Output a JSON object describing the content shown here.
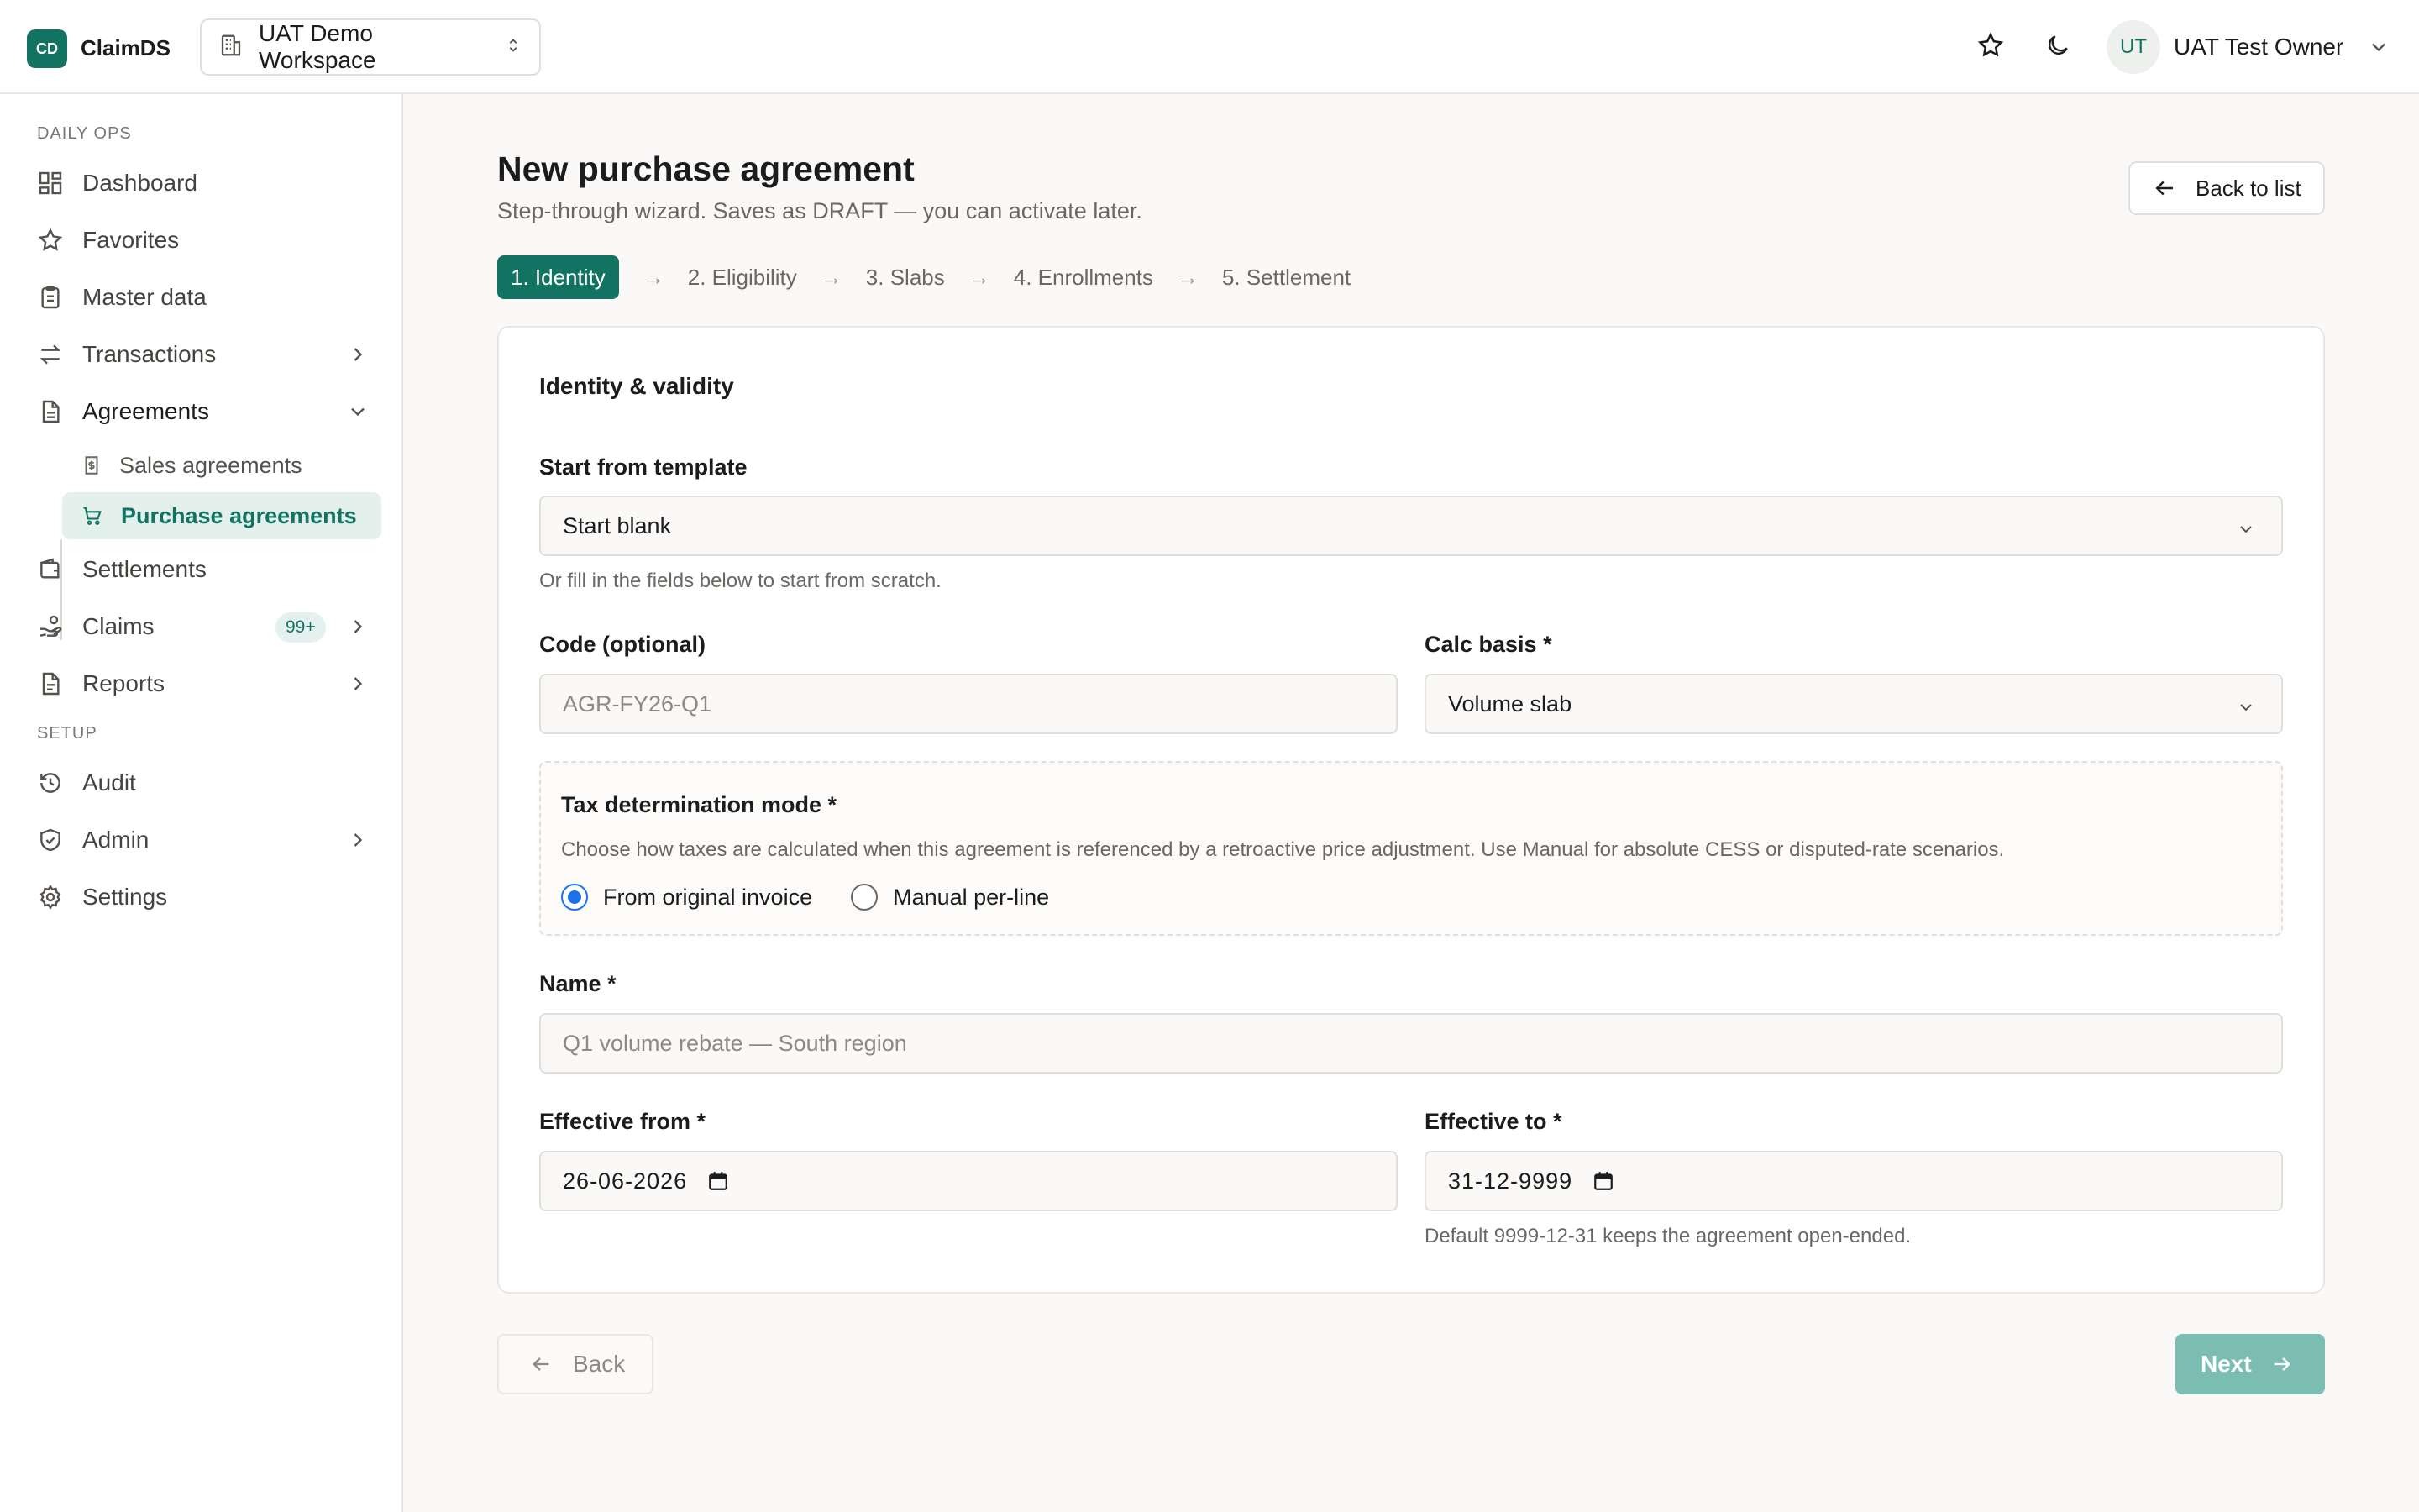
{
  "app": {
    "logo_initials": "CD",
    "name": "ClaimDS"
  },
  "workspace": {
    "label": "UAT Demo Workspace"
  },
  "user": {
    "initials": "UT",
    "name": "UAT Test Owner"
  },
  "sidebar": {
    "section_daily": "DAILY OPS",
    "section_setup": "SETUP",
    "items": {
      "dashboard": "Dashboard",
      "favorites": "Favorites",
      "master_data": "Master data",
      "transactions": "Transactions",
      "agreements": "Agreements",
      "sales_agreements": "Sales agreements",
      "purchase_agreements": "Purchase agreements",
      "settlements": "Settlements",
      "claims": "Claims",
      "claims_badge": "99+",
      "reports": "Reports",
      "audit": "Audit",
      "admin": "Admin",
      "settings": "Settings"
    }
  },
  "page": {
    "title": "New purchase agreement",
    "subtitle": "Step-through wizard. Saves as DRAFT — you can activate later.",
    "back_to_list": "Back to list"
  },
  "steps": [
    "1. Identity",
    "2. Eligibility",
    "3. Slabs",
    "4. Enrollments",
    "5. Settlement"
  ],
  "step_arrow": "→",
  "form": {
    "card_title": "Identity & validity",
    "template_label": "Start from template",
    "template_value": "Start blank",
    "template_hint": "Or fill in the fields below to start from scratch.",
    "code_label": "Code (optional)",
    "code_placeholder": "AGR-FY26-Q1",
    "calc_label": "Calc basis *",
    "calc_value": "Volume slab",
    "tax_label": "Tax determination mode *",
    "tax_hint": "Choose how taxes are calculated when this agreement is referenced by a retroactive price adjustment. Use Manual for absolute CESS or disputed-rate scenarios.",
    "tax_option_original": "From original invoice",
    "tax_option_manual": "Manual per-line",
    "name_label": "Name *",
    "name_placeholder": "Q1 volume rebate — South region",
    "from_label": "Effective from *",
    "from_value": "26-06-2026",
    "to_label": "Effective to *",
    "to_value": "31-12-9999",
    "to_hint": "Default 9999-12-31 keeps the agreement open-ended."
  },
  "footer": {
    "back": "Back",
    "next": "Next"
  },
  "colors": {
    "accent": "#137363",
    "next_disabled": "#7bbdb2",
    "radio": "#1a73e8"
  }
}
